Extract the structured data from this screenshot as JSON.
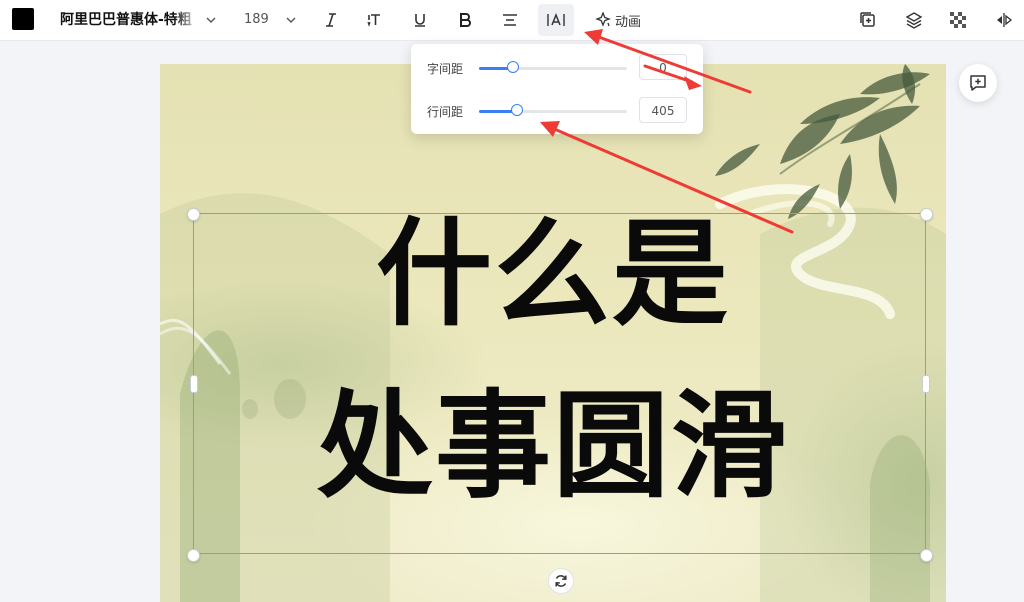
{
  "toolbar": {
    "text_color": "#000000",
    "font_name": "阿里巴巴普惠体-特粗",
    "font_size": "189",
    "icons": [
      "chevron-down-icon",
      "italic-icon",
      "text-transform-icon",
      "underline-icon",
      "bold-icon",
      "align-center-icon",
      "spacing-icon",
      "animation-icon",
      "layer-add-icon",
      "layers-icon",
      "transparency-icon",
      "flip-icon"
    ],
    "animation_label": "动画"
  },
  "spacing_popover": {
    "letter_spacing": {
      "label": "字间距",
      "value": "0",
      "fraction": 0.23
    },
    "line_spacing": {
      "label": "行间距",
      "value": "405",
      "fraction": 0.26
    }
  },
  "canvas": {
    "lines": [
      "什么是",
      "处事圆滑"
    ],
    "accent": "#3b7ff2"
  },
  "annotation_color": "#ee3b36"
}
